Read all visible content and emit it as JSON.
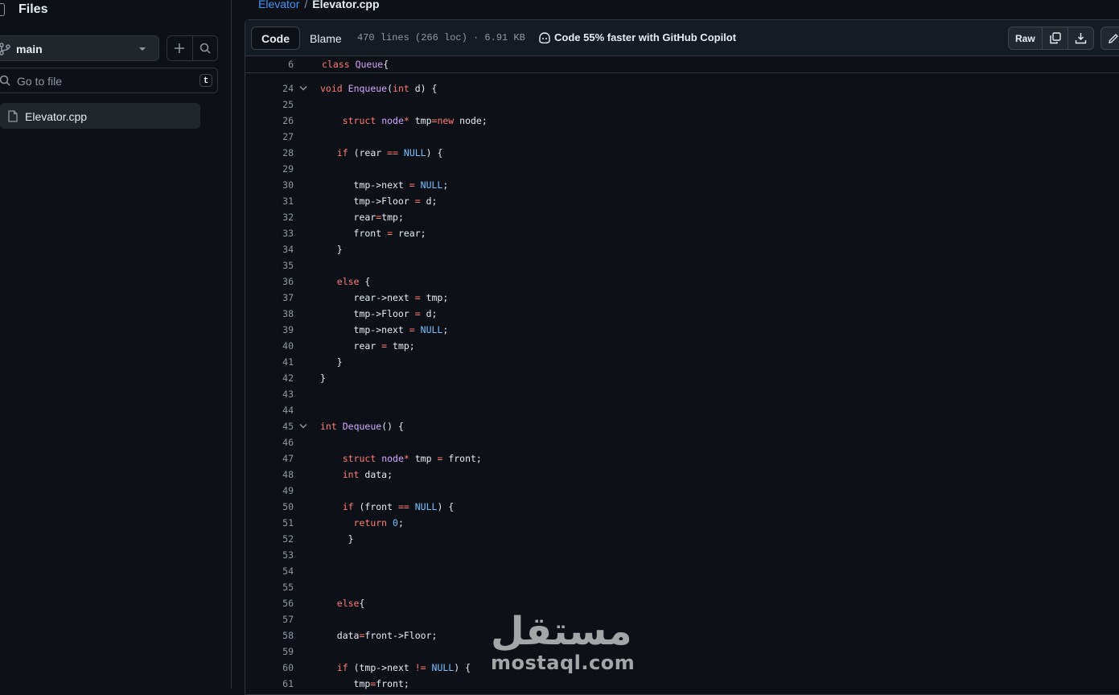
{
  "sidebar": {
    "title": "Files",
    "branch": "main",
    "goto_placeholder": "Go to file",
    "goto_shortcut": "t",
    "files": [
      {
        "name": "Elevator.cpp"
      }
    ]
  },
  "breadcrumb": {
    "repo": "Elevator",
    "separator": "/",
    "file": "Elevator.cpp"
  },
  "toolbar": {
    "tab_code": "Code",
    "tab_blame": "Blame",
    "meta": "470 lines (266 loc) · 6.91 KB",
    "copilot": "Code 55% faster with GitHub Copilot",
    "raw": "Raw"
  },
  "sticky": {
    "number": "6",
    "text": "class Queue{"
  },
  "code_lines": [
    {
      "n": "24",
      "fold": true,
      "html": "<span class=\"ty\">void</span> <span class=\"fn\">Enqueue</span>(<span class=\"ty\">int</span> d) {"
    },
    {
      "n": "25",
      "html": ""
    },
    {
      "n": "26",
      "html": "    <span class=\"kw\">struct</span> <span class=\"fn\">node</span><span class=\"kw\">*</span> tmp<span class=\"kw\">=new</span> node;"
    },
    {
      "n": "27",
      "html": ""
    },
    {
      "n": "28",
      "html": "   <span class=\"kw\">if</span> (rear <span class=\"kw\">==</span> <span class=\"cn\">NULL</span>) {"
    },
    {
      "n": "29",
      "html": ""
    },
    {
      "n": "30",
      "html": "      tmp-&gt;next <span class=\"kw\">=</span> <span class=\"cn\">NULL</span>;"
    },
    {
      "n": "31",
      "html": "      tmp-&gt;Floor <span class=\"kw\">=</span> d;"
    },
    {
      "n": "32",
      "html": "      rear<span class=\"kw\">=</span>tmp;"
    },
    {
      "n": "33",
      "html": "      front <span class=\"kw\">=</span> rear;"
    },
    {
      "n": "34",
      "html": "   }"
    },
    {
      "n": "35",
      "html": ""
    },
    {
      "n": "36",
      "html": "   <span class=\"kw\">else</span> {"
    },
    {
      "n": "37",
      "html": "      rear-&gt;next <span class=\"kw\">=</span> tmp;"
    },
    {
      "n": "38",
      "html": "      tmp-&gt;Floor <span class=\"kw\">=</span> d;"
    },
    {
      "n": "39",
      "html": "      tmp-&gt;next <span class=\"kw\">=</span> <span class=\"cn\">NULL</span>;"
    },
    {
      "n": "40",
      "html": "      rear <span class=\"kw\">=</span> tmp;"
    },
    {
      "n": "41",
      "html": "   }"
    },
    {
      "n": "42",
      "html": "}"
    },
    {
      "n": "43",
      "html": ""
    },
    {
      "n": "44",
      "html": ""
    },
    {
      "n": "45",
      "fold": true,
      "html": "<span class=\"ty\">int</span> <span class=\"fn\">Dequeue</span>() {"
    },
    {
      "n": "46",
      "html": ""
    },
    {
      "n": "47",
      "html": "    <span class=\"kw\">struct</span> <span class=\"fn\">node</span><span class=\"kw\">*</span> tmp <span class=\"kw\">=</span> front;"
    },
    {
      "n": "48",
      "html": "    <span class=\"ty\">int</span> data;"
    },
    {
      "n": "49",
      "html": ""
    },
    {
      "n": "50",
      "html": "    <span class=\"kw\">if</span> (front <span class=\"kw\">==</span> <span class=\"cn\">NULL</span>) {"
    },
    {
      "n": "51",
      "html": "      <span class=\"kw\">return</span> <span class=\"cn\">0</span>;"
    },
    {
      "n": "52",
      "html": "     }"
    },
    {
      "n": "53",
      "html": ""
    },
    {
      "n": "54",
      "html": ""
    },
    {
      "n": "55",
      "html": ""
    },
    {
      "n": "56",
      "html": "   <span class=\"kw\">else</span>{"
    },
    {
      "n": "57",
      "html": ""
    },
    {
      "n": "58",
      "html": "   data<span class=\"kw\">=</span>front-&gt;Floor;"
    },
    {
      "n": "59",
      "html": ""
    },
    {
      "n": "60",
      "html": "   <span class=\"kw\">if</span> (tmp-&gt;next <span class=\"kw\">!=</span> <span class=\"cn\">NULL</span>) {"
    },
    {
      "n": "61",
      "html": "      tmp<span class=\"kw\">=</span>front;"
    }
  ],
  "watermark": {
    "arabic": "مستقل",
    "latin": "mostaql.com"
  }
}
